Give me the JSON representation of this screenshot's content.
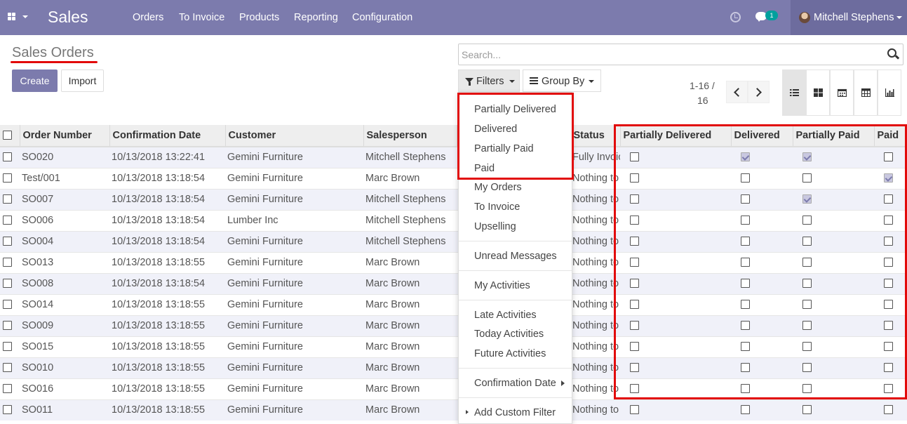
{
  "app": {
    "brand": "Sales",
    "menu": [
      "Orders",
      "To Invoice",
      "Products",
      "Reporting",
      "Configuration"
    ],
    "chat_count": "1",
    "user_name": "Mitchell Stephens"
  },
  "page": {
    "title": "Sales Orders",
    "create_label": "Create",
    "import_label": "Import"
  },
  "search": {
    "placeholder": "Search..."
  },
  "filters_label": "Filters",
  "groupby_label": "Group By",
  "pager": {
    "value": "1-16 /",
    "total": "16"
  },
  "views": [
    "list-view",
    "kanban-view",
    "calendar-view",
    "pivot-view",
    "graph-view"
  ],
  "table": {
    "columns": [
      "Order Number",
      "Confirmation Date",
      "Customer",
      "Salesperson",
      "Status",
      "Partially Delivered",
      "Delivered",
      "Partially Paid",
      "Paid"
    ],
    "rows": [
      {
        "order": "SO020",
        "date": "10/13/2018 13:22:41",
        "customer": "Gemini Furniture",
        "salesperson": "Mitchell Stephens",
        "status": "Fully Invoiced",
        "pd": false,
        "d": true,
        "pp": true,
        "p": false
      },
      {
        "order": "Test/001",
        "date": "10/13/2018 13:18:54",
        "customer": "Gemini Furniture",
        "salesperson": "Marc Brown",
        "status": "Nothing to Invoice",
        "pd": false,
        "d": false,
        "pp": false,
        "p": true
      },
      {
        "order": "SO007",
        "date": "10/13/2018 13:18:54",
        "customer": "Gemini Furniture",
        "salesperson": "Mitchell Stephens",
        "status": "Nothing to Invoice",
        "pd": false,
        "d": false,
        "pp": true,
        "p": false
      },
      {
        "order": "SO006",
        "date": "10/13/2018 13:18:54",
        "customer": "Lumber Inc",
        "salesperson": "Mitchell Stephens",
        "status": "Nothing to Invoice",
        "pd": false,
        "d": false,
        "pp": false,
        "p": false
      },
      {
        "order": "SO004",
        "date": "10/13/2018 13:18:54",
        "customer": "Gemini Furniture",
        "salesperson": "Mitchell Stephens",
        "status": "Nothing to Invoice",
        "pd": false,
        "d": false,
        "pp": false,
        "p": false
      },
      {
        "order": "SO013",
        "date": "10/13/2018 13:18:55",
        "customer": "Gemini Furniture",
        "salesperson": "Marc Brown",
        "status": "Nothing to Invoice",
        "pd": false,
        "d": false,
        "pp": false,
        "p": false
      },
      {
        "order": "SO008",
        "date": "10/13/2018 13:18:54",
        "customer": "Gemini Furniture",
        "salesperson": "Marc Brown",
        "status": "Nothing to Invoice",
        "pd": false,
        "d": false,
        "pp": false,
        "p": false
      },
      {
        "order": "SO014",
        "date": "10/13/2018 13:18:55",
        "customer": "Gemini Furniture",
        "salesperson": "Marc Brown",
        "status": "Nothing to Invoice",
        "pd": false,
        "d": false,
        "pp": false,
        "p": false
      },
      {
        "order": "SO009",
        "date": "10/13/2018 13:18:55",
        "customer": "Gemini Furniture",
        "salesperson": "Marc Brown",
        "status": "Nothing to Invoice",
        "pd": false,
        "d": false,
        "pp": false,
        "p": false
      },
      {
        "order": "SO015",
        "date": "10/13/2018 13:18:55",
        "customer": "Gemini Furniture",
        "salesperson": "Marc Brown",
        "status": "Nothing to Invoice",
        "pd": false,
        "d": false,
        "pp": false,
        "p": false
      },
      {
        "order": "SO010",
        "date": "10/13/2018 13:18:55",
        "customer": "Gemini Furniture",
        "salesperson": "Marc Brown",
        "status": "Nothing to Invoice",
        "pd": false,
        "d": false,
        "pp": false,
        "p": false
      },
      {
        "order": "SO016",
        "date": "10/13/2018 13:18:55",
        "customer": "Gemini Furniture",
        "salesperson": "Marc Brown",
        "status": "Nothing to Invoice",
        "pd": false,
        "d": false,
        "pp": false,
        "p": false
      },
      {
        "order": "SO011",
        "date": "10/13/2018 13:18:55",
        "customer": "Gemini Furniture",
        "salesperson": "Marc Brown",
        "status": "Nothing to Invoice",
        "pd": false,
        "d": false,
        "pp": false,
        "p": false
      }
    ]
  },
  "filters_menu": {
    "custom": [
      "Partially Delivered",
      "Delivered",
      "Partially Paid",
      "Paid"
    ],
    "group1": [
      "My Orders",
      "To Invoice",
      "Upselling"
    ],
    "group2": [
      "Unread Messages"
    ],
    "group3": [
      "My Activities"
    ],
    "group4": [
      "Late Activities",
      "Today Activities",
      "Future Activities"
    ],
    "group5": [
      "Confirmation Date"
    ],
    "add_custom": "Add Custom Filter"
  },
  "colors": {
    "navbar": "#7c7bad",
    "highlight": "#e20a0a"
  }
}
